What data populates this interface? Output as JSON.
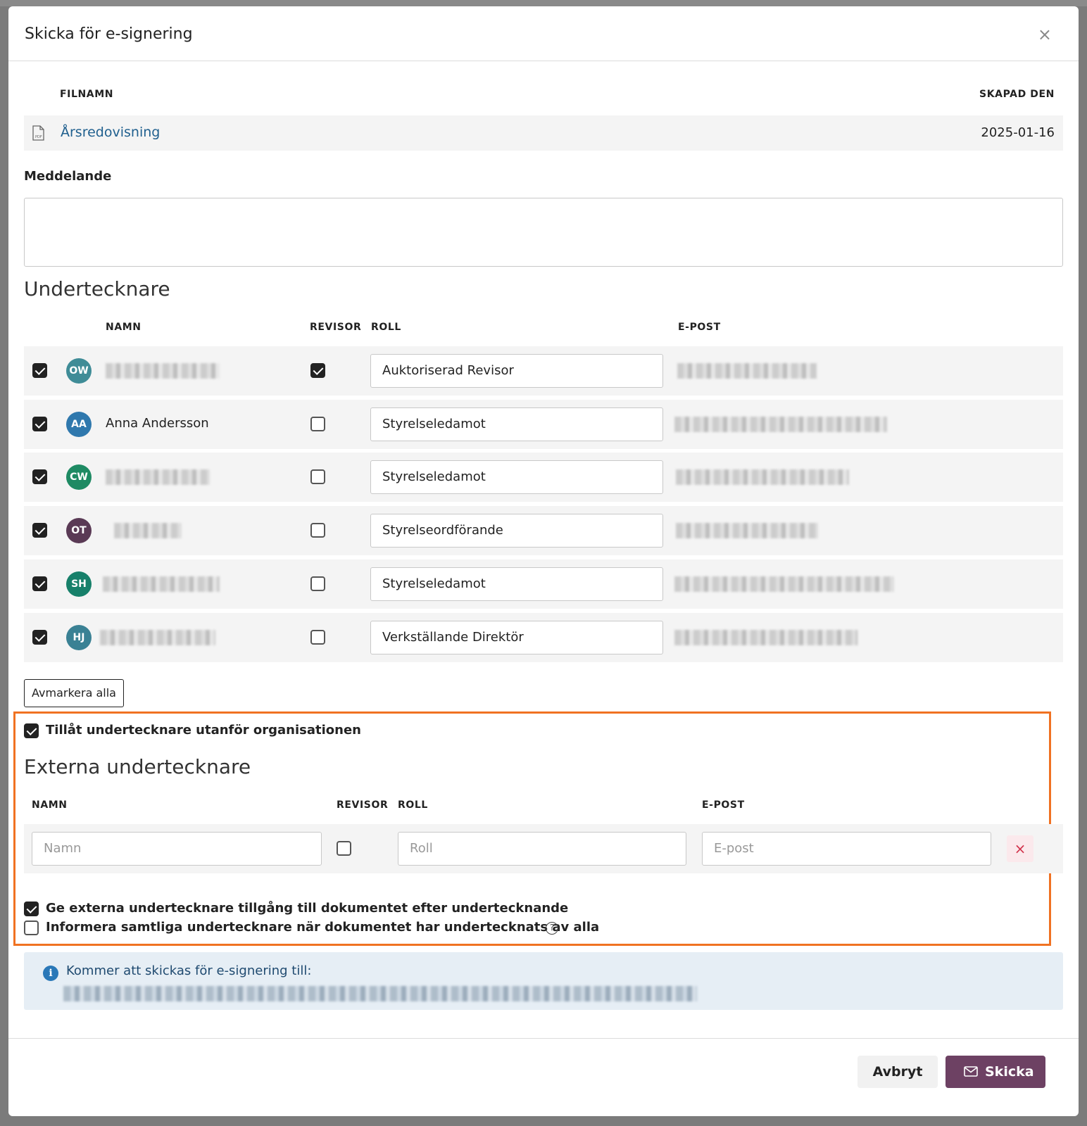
{
  "modal": {
    "title": "Skicka för e-signering",
    "close_label": "×"
  },
  "files": {
    "col_filename": "FILNAMN",
    "col_created": "SKAPAD DEN",
    "rows": [
      {
        "name": "Årsredovisning",
        "created": "2025-01-16",
        "icon": "pdf-file-icon"
      }
    ]
  },
  "message": {
    "label": "Meddelande",
    "value": ""
  },
  "signers": {
    "heading": "Undertecknare",
    "col_name": "NAMN",
    "col_auditor": "REVISOR",
    "col_role": "ROLL",
    "col_email": "E-POST",
    "rows": [
      {
        "selected": true,
        "initials": "OW",
        "avatar_color": "#3f8c97",
        "name": "",
        "name_redacted": true,
        "auditor": true,
        "role": "Auktoriserad Revisor",
        "email_redacted": true
      },
      {
        "selected": true,
        "initials": "AA",
        "avatar_color": "#2f78ad",
        "name": "Anna Andersson",
        "name_redacted": false,
        "auditor": false,
        "role": "Styrelseledamot",
        "email_redacted": true
      },
      {
        "selected": true,
        "initials": "CW",
        "avatar_color": "#1e8a63",
        "name": "",
        "name_redacted": true,
        "auditor": false,
        "role": "Styrelseledamot",
        "email_redacted": true
      },
      {
        "selected": true,
        "initials": "OT",
        "avatar_color": "#5a3a55",
        "name": "",
        "name_redacted": true,
        "auditor": false,
        "role": "Styrelseordförande",
        "email_redacted": true
      },
      {
        "selected": true,
        "initials": "SH",
        "avatar_color": "#17806a",
        "name": "",
        "name_redacted": true,
        "auditor": false,
        "role": "Styrelseledamot",
        "email_redacted": true
      },
      {
        "selected": true,
        "initials": "HJ",
        "avatar_color": "#3a8194",
        "name": "",
        "name_redacted": true,
        "auditor": false,
        "role": "Verkställande Direktör",
        "email_redacted": true
      }
    ],
    "deselect_all_label": "Avmarkera alla"
  },
  "external": {
    "allow_label": "Tillåt undertecknare utanför organisationen",
    "allow_checked": true,
    "heading": "Externa undertecknare",
    "col_name": "NAMN",
    "col_auditor": "REVISOR",
    "col_role": "ROLL",
    "col_email": "E-POST",
    "row": {
      "name_placeholder": "Namn",
      "role_placeholder": "Roll",
      "email_placeholder": "E-post",
      "auditor": false,
      "remove_label": "×"
    },
    "access_label": "Ge externa undertecknare tillgång till dokumentet efter undertecknande",
    "access_checked": true,
    "inform_label": "Informera samtliga undertecknare när dokumentet har undertecknats av alla",
    "inform_checked": false,
    "help_glyph": "?"
  },
  "info": {
    "text": "Kommer att skickas för e-signering till:",
    "recipients_redacted": true
  },
  "footer": {
    "cancel_label": "Avbryt",
    "send_label": "Skicka"
  },
  "colors": {
    "accent": "#6d4163",
    "highlight": "#f07222",
    "link": "#1f5f8e",
    "info_bg": "#e6eef5"
  }
}
